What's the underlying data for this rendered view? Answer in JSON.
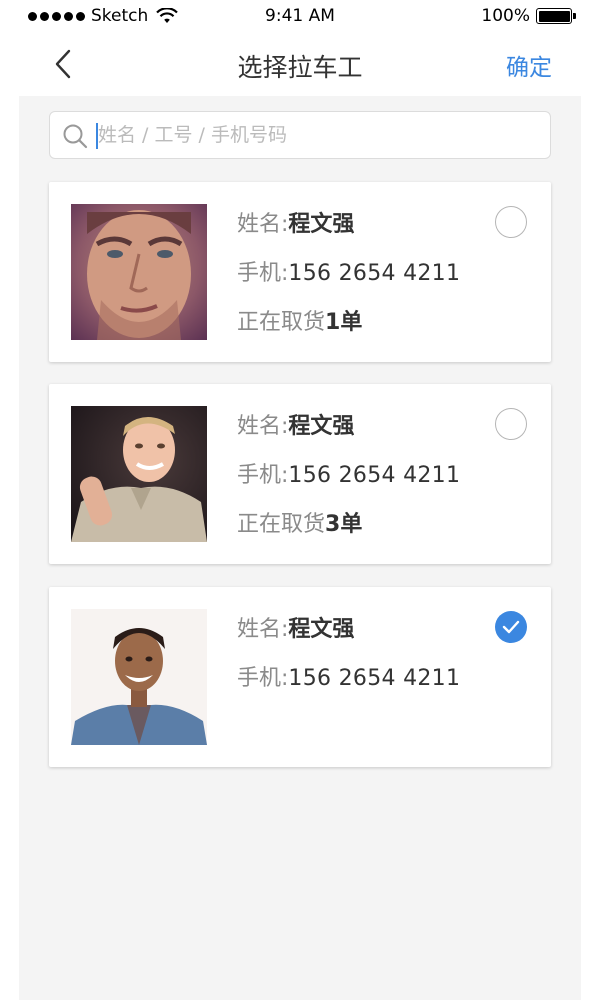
{
  "status_bar": {
    "carrier": "Sketch",
    "time": "9:41 AM",
    "battery": "100%"
  },
  "nav": {
    "title": "选择拉车工",
    "confirm_label": "确定"
  },
  "search": {
    "placeholder": "姓名 / 工号 / 手机号码",
    "value": ""
  },
  "labels": {
    "name": "姓名:",
    "phone": "手机:",
    "picking_prefix": "正在取货"
  },
  "workers": [
    {
      "name": "程文强",
      "phone": "156 2654 4211",
      "picking_count": "1单",
      "selected": false,
      "avatar": "man-beard-purple-avatar"
    },
    {
      "name": "程文强",
      "phone": "156 2654 4211",
      "picking_count": "3单",
      "selected": false,
      "avatar": "man-smiling-polo-avatar"
    },
    {
      "name": "程文强",
      "phone": "156 2654 4211",
      "picking_count": "",
      "selected": true,
      "avatar": "man-denim-jacket-avatar"
    }
  ],
  "colors": {
    "accent": "#3b87e0",
    "background": "#f4f4f4",
    "label": "#8a8a8a",
    "text": "#333333"
  }
}
